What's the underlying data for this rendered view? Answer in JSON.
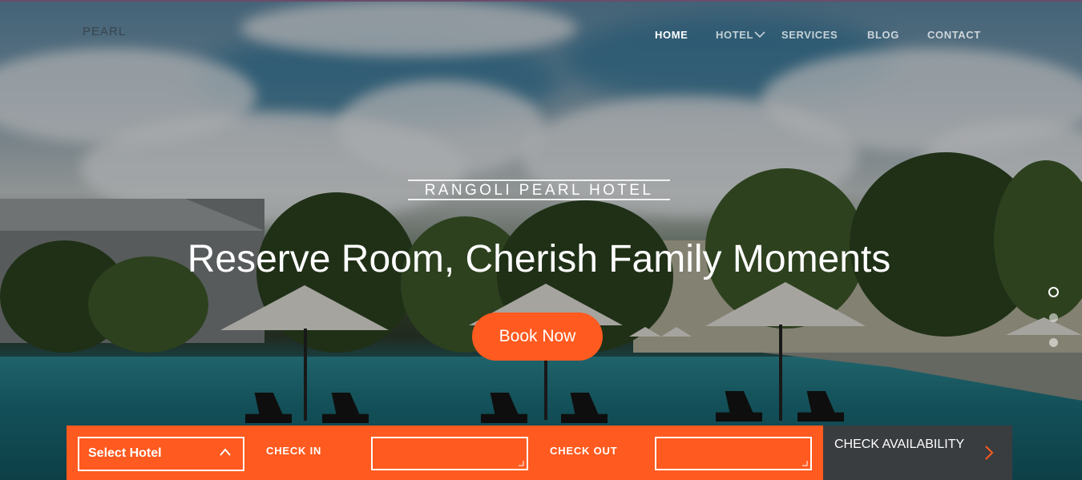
{
  "brand": {
    "logo": "PEARL"
  },
  "nav": {
    "items": [
      {
        "label": "HOME",
        "active": true
      },
      {
        "label": "HOTEL",
        "active": false,
        "has_dropdown": true
      },
      {
        "label": "SERVICES",
        "active": false
      },
      {
        "label": "BLOG",
        "active": false
      },
      {
        "label": "CONTACT",
        "active": false
      }
    ]
  },
  "hero": {
    "subtitle": "RANGOLI PEARL HOTEL",
    "headline": "Reserve Room, Cherish Family Moments",
    "cta_label": "Book Now",
    "slides": {
      "count": 3,
      "active_index": 0
    }
  },
  "booking": {
    "select_hotel_label": "Select Hotel",
    "check_in_label": "CHECK IN",
    "check_in_value": "",
    "check_out_label": "CHECK OUT",
    "check_out_value": "",
    "check_availability_label": "CHECK AVAILABILITY"
  },
  "icons": {
    "hotel_dropdown": "chevron-down-icon",
    "select_caret": "chevron-up-icon",
    "check_arrow": "chevron-right-icon"
  },
  "colors": {
    "accent": "#ff5a1f",
    "dark_button": "#3a3d40",
    "text_light": "#ffffff"
  }
}
